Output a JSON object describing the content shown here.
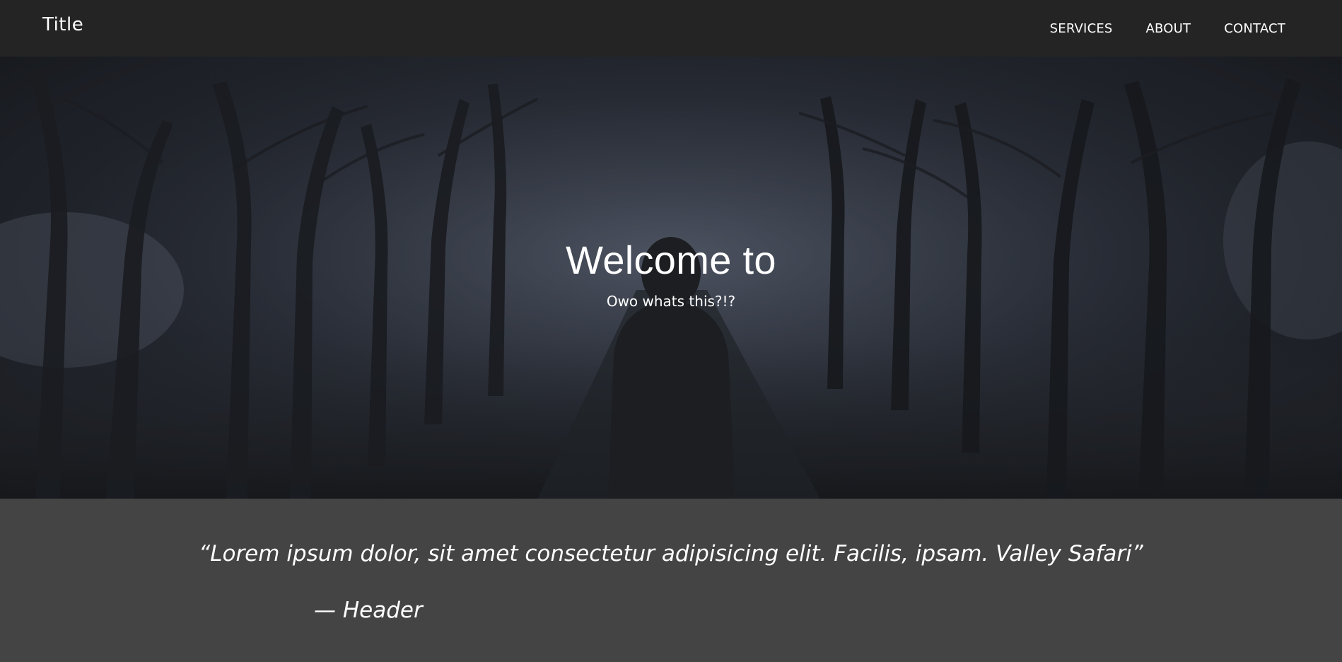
{
  "navbar": {
    "brand": "Title",
    "links": [
      {
        "label": "SERVICES"
      },
      {
        "label": "ABOUT"
      },
      {
        "label": "CONTACT"
      }
    ]
  },
  "hero": {
    "title": "Welcome to",
    "subtitle": "Owo whats this?!?",
    "background_image": "foggy-forest-road-hooded-figure"
  },
  "quote": {
    "text": "“Lorem ipsum dolor, sit amet consectetur adipisicing elit. Facilis, ipsam. Valley Safari”",
    "author": "— Header"
  },
  "colors": {
    "navbar_bg": "#242424",
    "quote_bg": "#444444",
    "text": "#ffffff"
  }
}
